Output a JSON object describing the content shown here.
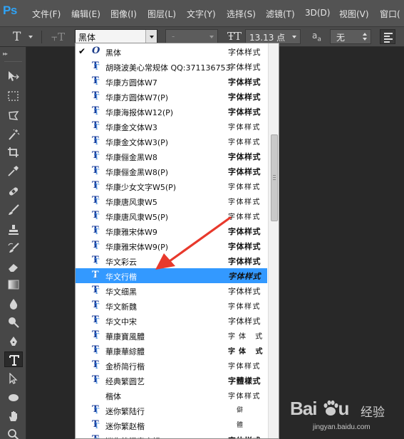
{
  "app": {
    "logo": "Ps"
  },
  "menubar": {
    "items": [
      "文件(F)",
      "编辑(E)",
      "图像(I)",
      "图层(L)",
      "文字(Y)",
      "选择(S)",
      "滤镜(T)",
      "3D(D)",
      "视图(V)",
      "窗口("
    ]
  },
  "options": {
    "tool_icon": "type-tool-icon",
    "font_family": "黑体",
    "font_style": "-",
    "font_size": "13.13 点",
    "aa_label": "a",
    "aa_sub": "a",
    "aa_method": "无"
  },
  "font_list": {
    "items": [
      {
        "name": "黑体",
        "sample": "字体样式",
        "type": "opentype",
        "checked": true
      },
      {
        "name": "胡晓波美心常规体  QQ:371136753",
        "sample": "字体样式",
        "type": "truetype"
      },
      {
        "name": "华康方圆体W7",
        "sample": "字体样式",
        "type": "truetype",
        "style": "bold"
      },
      {
        "name": "华康方圆体W7(P)",
        "sample": "字体样式",
        "type": "truetype",
        "style": "bold"
      },
      {
        "name": "华康海报体W12(P)",
        "sample": "字体样式",
        "type": "truetype",
        "style": "bold"
      },
      {
        "name": "华康金文体W3",
        "sample": "字体样式",
        "type": "truetype",
        "style": "thin"
      },
      {
        "name": "华康金文体W3(P)",
        "sample": "字体样式",
        "type": "truetype",
        "style": "thin"
      },
      {
        "name": "华康俪金黑W8",
        "sample": "字体样式",
        "type": "truetype",
        "style": "bold"
      },
      {
        "name": "华康俪金黑W8(P)",
        "sample": "字体样式",
        "type": "truetype",
        "style": "bold"
      },
      {
        "name": "华康少女文字W5(P)",
        "sample": "字体样式",
        "type": "truetype",
        "style": "thin"
      },
      {
        "name": "华康唐风隶W5",
        "sample": "字体样式",
        "type": "truetype",
        "style": "thin"
      },
      {
        "name": "华康唐风隶W5(P)",
        "sample": "字体样式",
        "type": "truetype",
        "style": "thin"
      },
      {
        "name": "华康雅宋体W9",
        "sample": "字体样式",
        "type": "truetype",
        "style": "bold"
      },
      {
        "name": "华康雅宋体W9(P)",
        "sample": "字体样式",
        "type": "truetype",
        "style": "bold"
      },
      {
        "name": "华文彩云",
        "sample": "字体样式",
        "type": "truetype",
        "style": "bold"
      },
      {
        "name": "华文行楷",
        "sample": "字体样式",
        "type": "truetype",
        "style": "ital",
        "selected": true
      },
      {
        "name": "华文细黑",
        "sample": "字体样式",
        "type": "truetype"
      },
      {
        "name": "华文新魏",
        "sample": "字体样式",
        "type": "truetype",
        "style": "thin"
      },
      {
        "name": "华文中宋",
        "sample": "字体样式",
        "type": "truetype"
      },
      {
        "name": "華康寶風體",
        "sample": "字体  式",
        "type": "truetype",
        "style": "sparse"
      },
      {
        "name": "華康華綜體",
        "sample": "字体  式",
        "type": "truetype",
        "style": "sparse-bold"
      },
      {
        "name": "金桥简行楷",
        "sample": "字体样式",
        "type": "truetype",
        "style": "thin"
      },
      {
        "name": "经典繁圆艺",
        "sample": "字體樣式",
        "type": "truetype",
        "style": "bold"
      },
      {
        "name": "楷体",
        "sample": "字体样式",
        "type": "none",
        "style": "thin"
      },
      {
        "name": "迷你繁陆行",
        "sample": "僻",
        "type": "truetype",
        "style": "faint"
      },
      {
        "name": "迷你繁赵楷",
        "sample": "體",
        "type": "truetype",
        "style": "faint"
      },
      {
        "name": "迷你简汉真广标",
        "sample": "字体样式",
        "type": "truetype",
        "style": "bold"
      }
    ]
  },
  "watermark": {
    "brand": "Bai",
    "brand_suffix": "u",
    "cn": "经验",
    "url": "jingyan.baidu.com"
  },
  "colors": {
    "accent": "#3399ff",
    "arrow": "#e8392c",
    "ps_blue": "#2fa3f6"
  }
}
